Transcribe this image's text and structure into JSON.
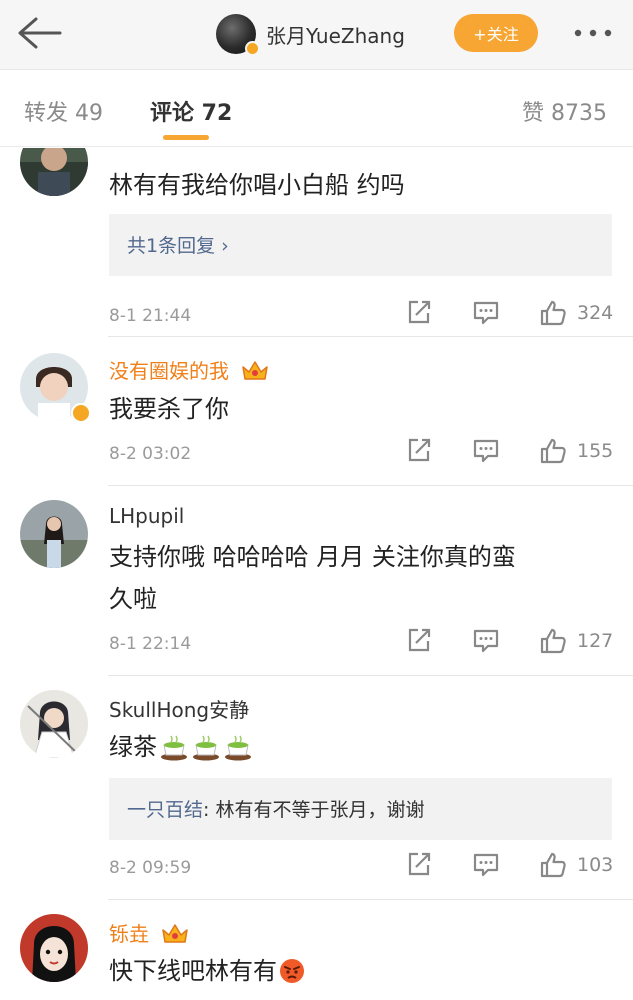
{
  "header": {
    "profile_name": "张月YueZhang",
    "follow_label": "+关注"
  },
  "tabs": {
    "repost": "转发 49",
    "comments": "评论 72",
    "likes": "赞 8735"
  },
  "comments": [
    {
      "username": "",
      "text": "林有有我给你唱小白船 约吗",
      "reply": {
        "link": "共1条回复",
        "arrow": "›",
        "text": ""
      },
      "time": "8-1 21:44",
      "likes": "324"
    },
    {
      "username": "没有圈娱的我",
      "text": "我要杀了你",
      "time": "8-2 03:02",
      "likes": "155"
    },
    {
      "username": "LHpupil",
      "text_line1": "支持你哦 哈哈哈哈  月月 关注你真的蛮",
      "text_line2": "久啦",
      "time": "8-1 22:14",
      "likes": "127"
    },
    {
      "username": "SkullHong安静",
      "text": "绿茶",
      "reply": {
        "link": "一只百结",
        "text": ": 林有有不等于张月，谢谢"
      },
      "time": "8-2 09:59",
      "likes": "103"
    },
    {
      "username": "铄垚",
      "text": "快下线吧林有有"
    }
  ],
  "icons": {
    "back": "back-arrow-icon",
    "more": "more-dots-icon",
    "share": "share-icon",
    "comment": "comment-icon",
    "like": "thumbs-up-icon",
    "crown": "crown-icon",
    "verified": "verified-badge-icon"
  },
  "colors": {
    "accent": "#f7a533",
    "vip_name": "#f0801a",
    "link": "#52698f"
  }
}
